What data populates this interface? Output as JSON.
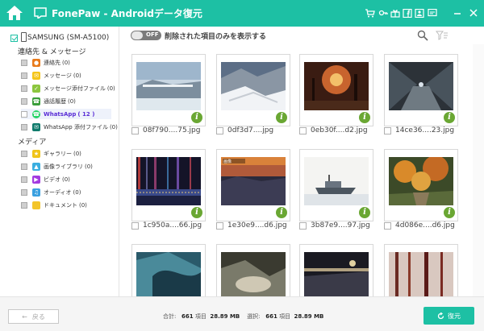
{
  "window": {
    "title": "FonePaw - Androidデータ復元",
    "toolbar_icons": [
      "cart-icon",
      "key-icon",
      "gift-icon",
      "facebook-icon",
      "register-icon",
      "chat-icon",
      "minimize-icon",
      "close-icon"
    ]
  },
  "sidebar": {
    "device": "SAMSUNG (SM-A5100)",
    "section_contacts": "連絡先 & メッセージ",
    "section_media": "メディア",
    "items": [
      {
        "label": "連絡先",
        "count": "(0)",
        "color": "#e87b1c"
      },
      {
        "label": "メッセージ",
        "count": "(0)",
        "color": "#f5c518"
      },
      {
        "label": "メッセージ添付ファイル",
        "count": "(0)",
        "color": "#8cc63f"
      },
      {
        "label": "通話履歴",
        "count": "(0)",
        "color": "#3a9d3a"
      },
      {
        "label": "WhatsApp",
        "count": "( 12 )",
        "color": "#25d366"
      },
      {
        "label": "WhatsApp 添付ファイル",
        "count": "(0)",
        "color": "#0f7b6c"
      },
      {
        "label": "ギャラリー",
        "count": "(0)",
        "color": "#f0c419"
      },
      {
        "label": "画像ライブラリ",
        "count": "(0)",
        "color": "#3aaee0"
      },
      {
        "label": "ビデオ",
        "count": "(0)",
        "color": "#a33be0"
      },
      {
        "label": "オーディオ",
        "count": "(0)",
        "color": "#3aa0e0"
      },
      {
        "label": "ドキュメント",
        "count": "(0)",
        "color": "#f3c52a"
      }
    ]
  },
  "toolbar": {
    "toggle": "OFF",
    "filter_label": "削除された項目のみを表示する"
  },
  "photos": [
    {
      "name": "08f790....75.jpg"
    },
    {
      "name": "0df3d7....jpg"
    },
    {
      "name": "0eb30f....d2.jpg"
    },
    {
      "name": "14ce36....23.jpg"
    },
    {
      "name": "1c950a....66.jpg"
    },
    {
      "name": "1e30e9....d6.jpg"
    },
    {
      "name": "3b87e9....97.jpg"
    },
    {
      "name": "4d086e....d6.jpg"
    },
    {
      "name": ""
    },
    {
      "name": ""
    },
    {
      "name": ""
    },
    {
      "name": ""
    }
  ],
  "bottom": {
    "back": "戻る",
    "total_label": "合計:",
    "total_count": "661",
    "items_unit": "項目",
    "total_size": "28.89 MB",
    "selected_label": "選択:",
    "selected_count": "661",
    "selected_unit": "項目",
    "selected_size": "28.89 MB",
    "recover": "復元"
  }
}
